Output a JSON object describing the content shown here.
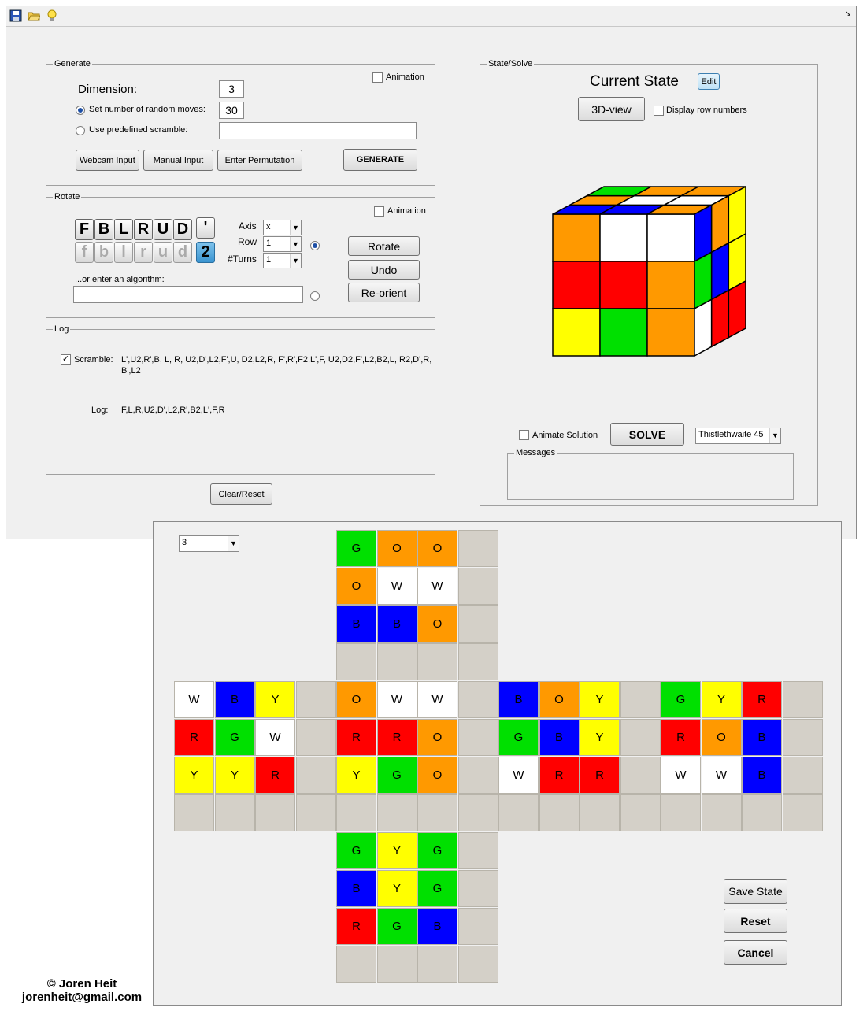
{
  "toolbar": {
    "icons": [
      "save-icon",
      "open-folder-icon",
      "lightbulb-icon"
    ],
    "corner_glyph": "↘"
  },
  "generate": {
    "title": "Generate",
    "animation_label": "Animation",
    "animation_checked": false,
    "dimension_label": "Dimension:",
    "dimension_value": "3",
    "random_moves_label": "Set number of random moves:",
    "random_moves_value": "30",
    "random_moves_selected": true,
    "predefined_label": "Use predefined scramble:",
    "predefined_value": "",
    "webcam_button": "Webcam Input",
    "manual_button": "Manual Input",
    "permutation_button": "Enter Permutation",
    "generate_button": "GENERATE"
  },
  "rotate": {
    "title": "Rotate",
    "animation_label": "Animation",
    "animation_checked": false,
    "moves_upper": [
      "F",
      "B",
      "L",
      "R",
      "U",
      "D"
    ],
    "prime": "'",
    "moves_lower": [
      "f",
      "b",
      "l",
      "r",
      "u",
      "d"
    ],
    "double": "2",
    "axis_label": "Axis",
    "axis_value": "x",
    "row_label": "Row",
    "row_value": "1",
    "turns_label": "#Turns",
    "turns_value": "1",
    "algorithm_label": "...or enter an algorithm:",
    "algorithm_value": "",
    "rotate_button": "Rotate",
    "undo_button": "Undo",
    "reorient_button": "Re-orient"
  },
  "log": {
    "title": "Log",
    "scramble_label": "Scramble:",
    "scramble_checked": true,
    "scramble_line1": "L',U2,R',B, L, R, U2,D',L2,F',U, D2,L2,R, F',R',F2,L',F, U2,D2,F',L2,B2,L, R2,D',R,",
    "scramble_line2": "B',L2",
    "log_label": "Log:",
    "log_value": "F,L,R,U2,D',L2,R',B2,L',F,R",
    "clear_button": "Clear/Reset"
  },
  "state": {
    "title": "State/Solve",
    "current_state": "Current State",
    "edit_button": "Edit",
    "view3d_button": "3D-view",
    "row_numbers_label": "Display row numbers",
    "row_numbers_checked": false,
    "animate_solution_label": "Animate Solution",
    "animate_solution_checked": false,
    "solve_button": "SOLVE",
    "algorithm_select": "Thistlethwaite 45",
    "messages_title": "Messages",
    "messages_text": ""
  },
  "cube3d": {
    "front": [
      [
        "O",
        "W",
        "W"
      ],
      [
        "R",
        "R",
        "O"
      ],
      [
        "Y",
        "G",
        "O"
      ]
    ],
    "top": [
      [
        "B",
        "B",
        "O"
      ],
      [
        "O",
        "W",
        "W"
      ],
      [
        "G",
        "O",
        "O"
      ]
    ],
    "right": [
      [
        "B",
        "O",
        "Y"
      ],
      [
        "G",
        "B",
        "Y"
      ],
      [
        "W",
        "R",
        "R"
      ]
    ],
    "colors": {
      "W": "#ffffff",
      "Y": "#ffff00",
      "R": "#ff0000",
      "G": "#00e000",
      "B": "#0000ff",
      "O": "#ff9900"
    }
  },
  "editor": {
    "size_select": "3",
    "save_button": "Save State",
    "reset_button": "Reset",
    "cancel_button": "Cancel",
    "top_face": [
      [
        "G",
        "O",
        "O"
      ],
      [
        "O",
        "W",
        "W"
      ],
      [
        "B",
        "B",
        "O"
      ]
    ],
    "left_face": [
      [
        "W",
        "B",
        "Y"
      ],
      [
        "R",
        "G",
        "W"
      ],
      [
        "Y",
        "Y",
        "R"
      ]
    ],
    "front_face": [
      [
        "O",
        "W",
        "W"
      ],
      [
        "R",
        "R",
        "O"
      ],
      [
        "Y",
        "G",
        "O"
      ]
    ],
    "right_face": [
      [
        "B",
        "O",
        "Y"
      ],
      [
        "G",
        "B",
        "Y"
      ],
      [
        "W",
        "R",
        "R"
      ]
    ],
    "back_face": [
      [
        "G",
        "Y",
        "R"
      ],
      [
        "R",
        "O",
        "B"
      ],
      [
        "W",
        "W",
        "B"
      ]
    ],
    "bottom_face": [
      [
        "G",
        "Y",
        "G"
      ],
      [
        "B",
        "Y",
        "G"
      ],
      [
        "R",
        "G",
        "B"
      ]
    ]
  },
  "credit": {
    "line1": "© Joren Heit",
    "line2": "jorenheit@gmail.com"
  }
}
